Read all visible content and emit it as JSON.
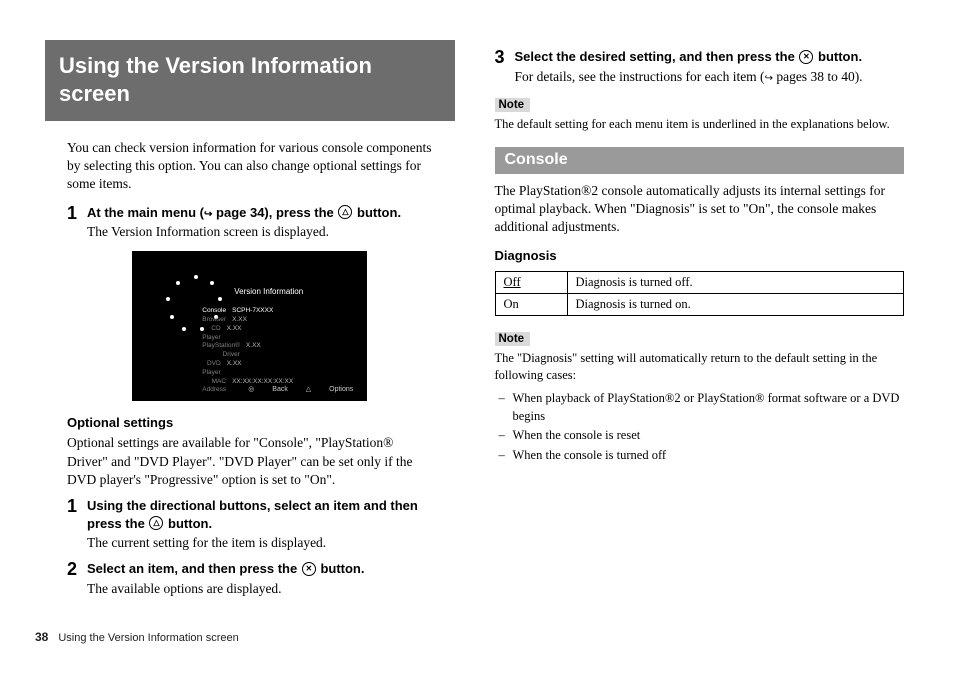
{
  "heading_main": "Using the Version Information screen",
  "intro": "You can check version information for various console components by selecting this option. You can also change optional settings for some items.",
  "left_steps": [
    {
      "num": "1",
      "title_before": "At the main menu (",
      "title_ref": " page 34), press the ",
      "title_button": "triangle",
      "title_after": " button.",
      "desc": "The Version Information screen is displayed."
    }
  ],
  "screenshot": {
    "title": "Version Information",
    "rows": [
      {
        "label": "Console",
        "value": "SCPH-7XXXX",
        "highlight": true
      },
      {
        "label": "Browser",
        "value": "X.XX"
      },
      {
        "label": "CD Player",
        "value": "X.XX"
      },
      {
        "label": "PlayStation® Driver",
        "value": "X.XX"
      },
      {
        "label": "DVD Player",
        "value": "X.XX"
      },
      {
        "label": "MAC Address",
        "value": "XX:XX:XX:XX:XX:XX"
      }
    ],
    "foot_back": "Back",
    "foot_options": "Options"
  },
  "optional_heading": "Optional settings",
  "optional_text": "Optional settings are available for \"Console\", \"PlayStation® Driver\" and \"DVD Player\". \"DVD Player\" can be set only if the DVD player's \"Progressive\" option is set to \"On\".",
  "opt_steps": [
    {
      "num": "1",
      "title_before": "Using the directional buttons, select an item and then press the ",
      "title_button": "triangle",
      "title_after": " button.",
      "desc": "The current setting for the item is displayed."
    },
    {
      "num": "2",
      "title_before": "Select an item, and then press the ",
      "title_button": "x",
      "title_after": " button.",
      "desc": "The available options are displayed."
    }
  ],
  "right_step": {
    "num": "3",
    "title_before": "Select the desired setting, and then press the ",
    "title_button": "x",
    "title_after": " button.",
    "desc_before": "For details, see the instructions for each item (",
    "desc_after": " pages 38 to 40)."
  },
  "note1_label": "Note",
  "note1_text": "The default setting for each menu item is underlined in the explanations below.",
  "section_console": "Console",
  "console_text": "The PlayStation®2 console automatically adjusts its internal settings for optimal playback. When \"Diagnosis\" is set to \"On\", the console makes additional adjustments.",
  "diag_heading": "Diagnosis",
  "diag_table": [
    {
      "opt": "Off",
      "underline": true,
      "desc": "Diagnosis is turned off."
    },
    {
      "opt": "On",
      "underline": false,
      "desc": "Diagnosis is turned on."
    }
  ],
  "note2_label": "Note",
  "note2_text": "The \"Diagnosis\" setting will automatically return to the default setting in the following cases:",
  "note2_list": [
    "When playback of PlayStation®2 or PlayStation® format software or a DVD begins",
    "When the console is reset",
    "When the console is turned off"
  ],
  "footer_page": "38",
  "footer_text": "Using the Version Information screen"
}
